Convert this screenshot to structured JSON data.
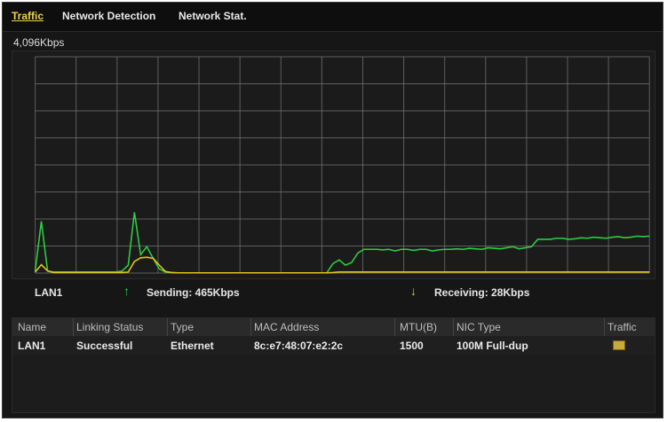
{
  "tabs": [
    {
      "label": "Traffic",
      "active": true
    },
    {
      "label": "Network Detection",
      "active": false
    },
    {
      "label": "Network Stat.",
      "active": false
    }
  ],
  "graph": {
    "scale_label": "4,096Kbps",
    "colors": {
      "sending": "#2ecc40",
      "receiving": "#e3c21b",
      "grid": "#7a7a7a"
    },
    "chart_data": {
      "type": "line",
      "x": [
        0,
        1,
        2,
        3,
        4,
        5,
        6,
        7,
        8,
        9,
        10,
        11,
        12,
        13,
        14,
        15,
        16,
        17,
        18,
        19,
        20,
        21,
        22,
        23,
        24,
        25,
        26,
        27,
        28,
        29,
        30,
        31,
        32,
        33,
        34,
        35,
        36,
        37,
        38,
        39,
        40,
        41,
        42,
        43,
        44,
        45,
        46,
        47,
        48,
        49,
        50,
        51,
        52,
        53,
        54,
        55,
        56,
        57,
        58,
        59,
        60,
        61,
        62,
        63,
        64,
        65,
        66,
        67,
        68,
        69,
        70,
        71,
        72,
        73,
        74,
        75,
        76,
        77,
        78,
        79,
        80,
        81,
        82,
        83,
        84,
        85,
        86,
        87,
        88,
        89,
        90,
        91,
        92,
        93,
        94,
        95,
        96,
        97,
        98,
        99
      ],
      "series": [
        {
          "name": "Sending",
          "values": [
            40,
            980,
            40,
            20,
            20,
            20,
            20,
            20,
            20,
            20,
            20,
            20,
            20,
            20,
            40,
            150,
            1150,
            350,
            500,
            280,
            80,
            20,
            10,
            5,
            5,
            5,
            5,
            5,
            5,
            5,
            5,
            5,
            5,
            5,
            5,
            5,
            5,
            5,
            5,
            5,
            5,
            5,
            5,
            5,
            5,
            5,
            5,
            5,
            180,
            250,
            150,
            200,
            380,
            450,
            450,
            450,
            440,
            450,
            420,
            450,
            450,
            430,
            450,
            450,
            420,
            440,
            450,
            450,
            460,
            450,
            470,
            460,
            450,
            480,
            470,
            460,
            480,
            500,
            460,
            480,
            500,
            640,
            640,
            640,
            660,
            660,
            640,
            650,
            670,
            660,
            680,
            670,
            660,
            680,
            690,
            670,
            680,
            700,
            690,
            700
          ]
        },
        {
          "name": "Receiving",
          "values": [
            20,
            160,
            40,
            10,
            10,
            10,
            10,
            10,
            10,
            10,
            10,
            10,
            10,
            10,
            10,
            20,
            220,
            290,
            300,
            280,
            150,
            30,
            10,
            5,
            5,
            5,
            5,
            5,
            5,
            5,
            5,
            5,
            5,
            5,
            5,
            5,
            5,
            5,
            5,
            5,
            5,
            5,
            5,
            5,
            5,
            5,
            5,
            5,
            10,
            20,
            20,
            20,
            20,
            20,
            20,
            20,
            20,
            20,
            20,
            20,
            20,
            20,
            20,
            20,
            20,
            20,
            20,
            20,
            20,
            20,
            20,
            20,
            20,
            20,
            20,
            20,
            20,
            20,
            20,
            20,
            20,
            20,
            20,
            20,
            20,
            20,
            20,
            20,
            20,
            20,
            20,
            20,
            20,
            20,
            20,
            20,
            20,
            20,
            20,
            20
          ]
        }
      ],
      "ylim": [
        0,
        4096
      ],
      "grid": true
    }
  },
  "legend": {
    "interface": "LAN1",
    "sending": "Sending: 465Kbps",
    "receiving": "Receiving: 28Kbps"
  },
  "table": {
    "headers": [
      "Name",
      "Linking Status",
      "Type",
      "MAC Address",
      "MTU(B)",
      "NIC Type",
      "Traffic"
    ],
    "rows": [
      {
        "name": "LAN1",
        "status": "Successful",
        "type": "Ethernet",
        "mac": "8c:e7:48:07:e2:2c",
        "mtu": "1500",
        "nic": "100M Full-dup"
      }
    ]
  }
}
